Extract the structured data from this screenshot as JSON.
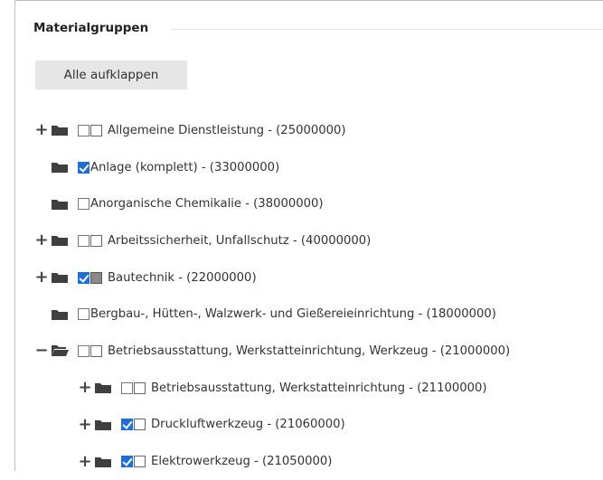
{
  "panel": {
    "legend": "Materialgruppen",
    "expand_all_label": "Alle aufklappen"
  },
  "tree": [
    {
      "label": "Allgemeine Dienstleistung - (25000000)",
      "level": 0,
      "toggle": "+",
      "checked": false,
      "square": "empty"
    },
    {
      "label": "Anlage (komplett) - (33000000)",
      "level": 0,
      "toggle": "",
      "checked": true,
      "square": "none"
    },
    {
      "label": "Anorganische Chemikalie - (38000000)",
      "level": 0,
      "toggle": "",
      "checked": false,
      "square": "none"
    },
    {
      "label": "Arbeitssicherheit, Unfallschutz - (40000000)",
      "level": 0,
      "toggle": "+",
      "checked": false,
      "square": "empty"
    },
    {
      "label": "Bautechnik - (22000000)",
      "level": 0,
      "toggle": "+",
      "checked": true,
      "square": "partial"
    },
    {
      "label": "Bergbau-, Hütten-, Walzwerk- und Gießereieinrichtung - (18000000)",
      "level": 0,
      "toggle": "",
      "checked": false,
      "square": "none"
    },
    {
      "label": "Betriebsausstattung, Werkstatteinrichtung, Werkzeug - (21000000)",
      "level": 0,
      "toggle": "−",
      "checked": false,
      "square": "empty",
      "open": true
    },
    {
      "label": "Betriebsausstattung, Werkstatteinrichtung - (21100000)",
      "level": 1,
      "toggle": "+",
      "checked": false,
      "square": "empty"
    },
    {
      "label": "Druckluftwerkzeug - (21060000)",
      "level": 1,
      "toggle": "+",
      "checked": true,
      "square": "empty"
    },
    {
      "label": "Elektrowerkzeug - (21050000)",
      "level": 1,
      "toggle": "+",
      "checked": true,
      "square": "empty"
    }
  ],
  "colors": {
    "checkbox_checked": "#1f6fd6",
    "folder": "#3f3f3f",
    "partial_square": "#8a8a8a"
  }
}
